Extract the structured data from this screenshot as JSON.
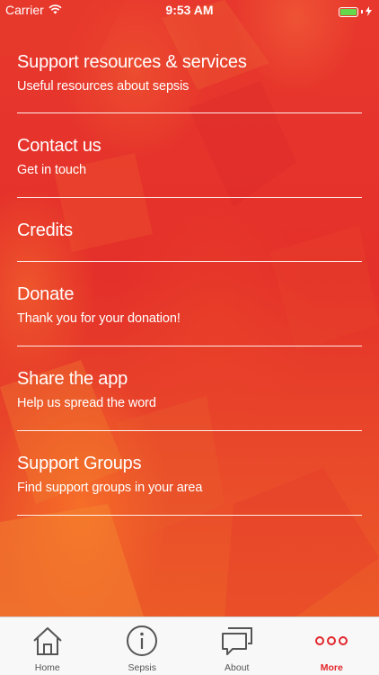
{
  "status_bar": {
    "carrier": "Carrier",
    "time": "9:53 AM"
  },
  "menu": {
    "items": [
      {
        "title": "Support resources & services",
        "subtitle": "Useful resources about sepsis"
      },
      {
        "title": "Contact us",
        "subtitle": "Get in touch"
      },
      {
        "title": "Credits",
        "subtitle": ""
      },
      {
        "title": "Donate",
        "subtitle": "Thank you for your donation!"
      },
      {
        "title": "Share the app",
        "subtitle": "Help us spread the word"
      },
      {
        "title": "Support Groups",
        "subtitle": "Find support groups in your area"
      }
    ]
  },
  "tab_bar": {
    "tabs": [
      {
        "label": "Home",
        "icon": "home-icon"
      },
      {
        "label": "Sepsis",
        "icon": "info-icon"
      },
      {
        "label": "About",
        "icon": "chat-icon"
      },
      {
        "label": "More",
        "icon": "more-icon",
        "active": true
      }
    ]
  },
  "colors": {
    "background": "#e52f2a",
    "active_tab": "#e2262b",
    "tab_bar_background": "#f8f8f8",
    "battery": "#63d84a"
  }
}
